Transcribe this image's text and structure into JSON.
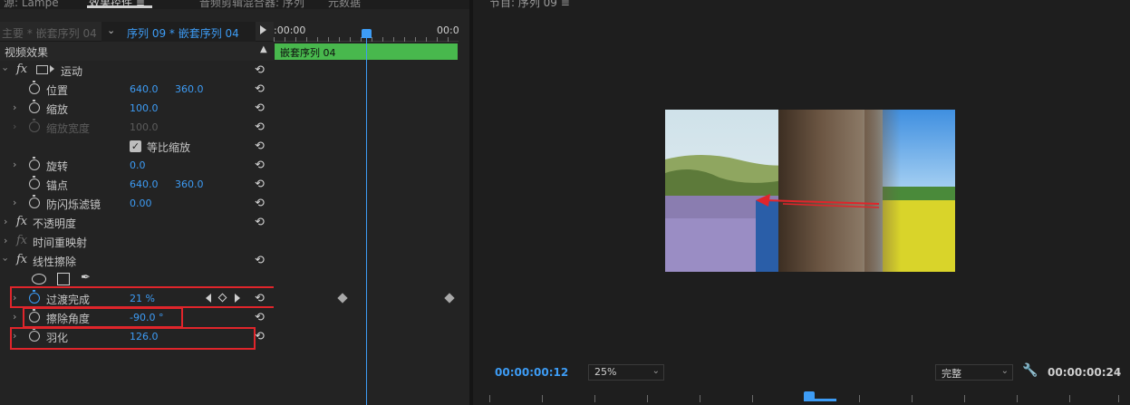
{
  "tabs": {
    "partial_left": "源: Lampe",
    "effect_controls": "效果控件 ≡",
    "audio_mixer": "音频剪辑混合器: 序列",
    "metadata": "元数据"
  },
  "sequence_header": {
    "master_clip": "主要 * 嵌套序列 04",
    "sequence_name": "序列 09 * 嵌套序列 04"
  },
  "ec_timeline": {
    "time_start": ":00:00",
    "time_end": "00:0",
    "clip_label": "嵌套序列 04"
  },
  "section_title": "视频效果",
  "effects": {
    "motion": "运动",
    "position": {
      "label": "位置",
      "x": "640.0",
      "y": "360.0"
    },
    "scale": {
      "label": "缩放",
      "value": "100.0"
    },
    "scale_width": {
      "label": "缩放宽度",
      "value": "100.0"
    },
    "uniform_scale": {
      "label": "等比缩放",
      "checked": true
    },
    "rotation": {
      "label": "旋转",
      "value": "0.0"
    },
    "anchor": {
      "label": "锚点",
      "x": "640.0",
      "y": "360.0"
    },
    "anti_flicker": {
      "label": "防闪烁滤镜",
      "value": "0.00"
    },
    "opacity": "不透明度",
    "time_remap": "时间重映射",
    "linear_wipe": "线性擦除",
    "transition_completion": {
      "label": "过渡完成",
      "value": "21 %"
    },
    "wipe_angle": {
      "label": "擦除角度",
      "value": "-90.0 °"
    },
    "feather": {
      "label": "羽化",
      "value": "126.0"
    }
  },
  "monitor": {
    "tab": "节目: 序列 09 ≡",
    "timecode_current": "00:00:00:12",
    "zoom": "25%",
    "quality": "完整",
    "timecode_duration": "00:00:00:24"
  },
  "icons": {
    "fx": "fx",
    "reset": "⟲",
    "twirl": "›",
    "wrench": "🔧"
  },
  "colors": {
    "accent_blue": "#3d9cf5",
    "clip_green": "#48b84d",
    "highlight_red": "#e0252b"
  }
}
